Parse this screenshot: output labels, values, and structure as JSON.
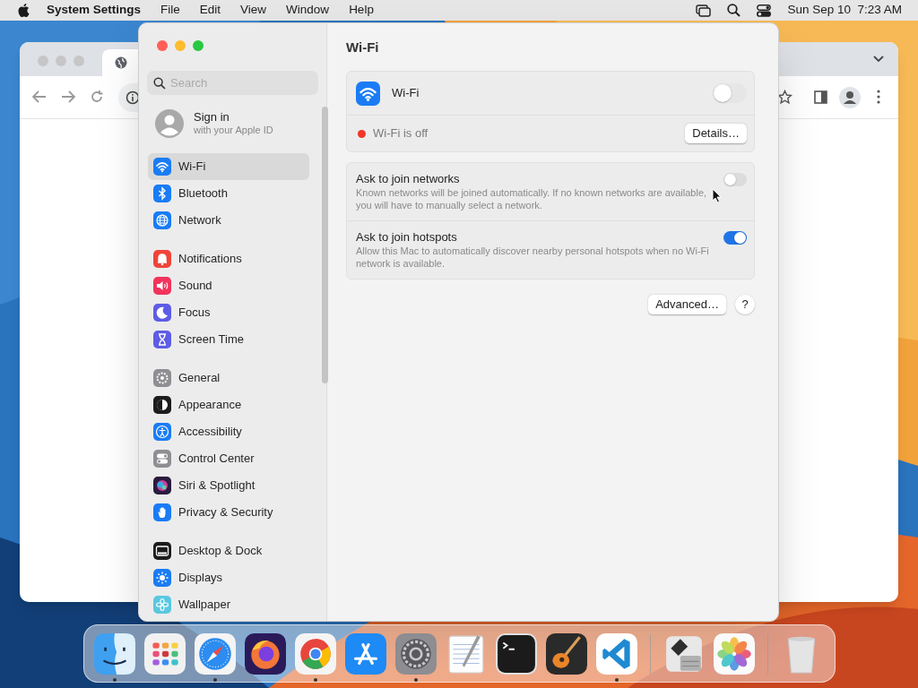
{
  "menu_bar": {
    "app_name": "System Settings",
    "menus": [
      "File",
      "Edit",
      "View",
      "Window",
      "Help"
    ],
    "clock": "Sun Sep 10  7:23 AM"
  },
  "sidebar": {
    "search": {
      "placeholder": "Search"
    },
    "account": {
      "title": "Sign in",
      "subtitle": "with your Apple ID"
    },
    "groups": [
      {
        "items": [
          {
            "label": "Wi-Fi",
            "kind": "wifi",
            "selected": true
          },
          {
            "label": "Bluetooth",
            "kind": "bluetooth",
            "selected": false
          },
          {
            "label": "Network",
            "kind": "network",
            "selected": false
          }
        ]
      },
      {
        "items": [
          {
            "label": "Notifications",
            "kind": "notifications",
            "selected": false
          },
          {
            "label": "Sound",
            "kind": "sound",
            "selected": false
          },
          {
            "label": "Focus",
            "kind": "focus",
            "selected": false
          },
          {
            "label": "Screen Time",
            "kind": "screentime",
            "selected": false
          }
        ]
      },
      {
        "items": [
          {
            "label": "General",
            "kind": "general",
            "selected": false
          },
          {
            "label": "Appearance",
            "kind": "appearance",
            "selected": false
          },
          {
            "label": "Accessibility",
            "kind": "accessibility",
            "selected": false
          },
          {
            "label": "Control Center",
            "kind": "controlcenter",
            "selected": false
          },
          {
            "label": "Siri & Spotlight",
            "kind": "siri",
            "selected": false
          },
          {
            "label": "Privacy & Security",
            "kind": "privacy",
            "selected": false
          }
        ]
      },
      {
        "items": [
          {
            "label": "Desktop & Dock",
            "kind": "dock",
            "selected": false
          },
          {
            "label": "Displays",
            "kind": "displays",
            "selected": false
          },
          {
            "label": "Wallpaper",
            "kind": "wallpaper",
            "selected": false
          }
        ]
      }
    ]
  },
  "content": {
    "title": "Wi-Fi",
    "wifi": {
      "label": "Wi-Fi",
      "on": false,
      "status": "Wi-Fi is off",
      "details_button": "Details…"
    },
    "options": [
      {
        "title": "Ask to join networks",
        "description": "Known networks will be joined automatically. If no known networks are available, you will have to manually select a network.",
        "on": false
      },
      {
        "title": "Ask to join hotspots",
        "description": "Allow this Mac to automatically discover nearby personal hotspots when no Wi-Fi network is available.",
        "on": true
      }
    ],
    "advanced_button": "Advanced…",
    "help_button": "?"
  },
  "dock": {
    "groups": [
      {
        "items": [
          {
            "kind": "finder",
            "running": true
          },
          {
            "kind": "launchpad",
            "running": false
          },
          {
            "kind": "safari",
            "running": true
          },
          {
            "kind": "firefox",
            "running": false
          },
          {
            "kind": "chrome",
            "running": true
          },
          {
            "kind": "appstore",
            "running": false
          },
          {
            "kind": "settings",
            "running": true
          },
          {
            "kind": "textedit",
            "running": false
          },
          {
            "kind": "terminal",
            "running": false
          },
          {
            "kind": "garageband",
            "running": false
          },
          {
            "kind": "vscode",
            "running": true
          }
        ]
      },
      {
        "items": [
          {
            "kind": "bootcamp",
            "running": false
          },
          {
            "kind": "photos",
            "running": false
          }
        ]
      },
      {
        "items": [
          {
            "kind": "trash",
            "running": false
          }
        ]
      }
    ]
  }
}
